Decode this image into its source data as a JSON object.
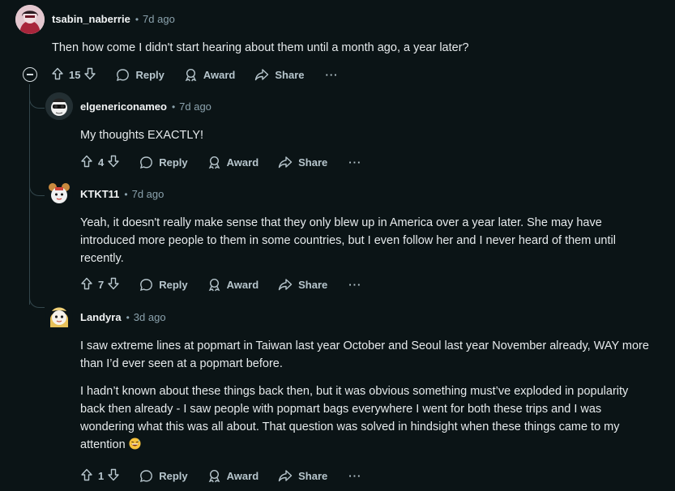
{
  "comments": [
    {
      "username": "tsabin_naberrie",
      "time": "7d ago",
      "body": [
        "Then how come I didn't start hearing about them until a month ago, a year later?"
      ],
      "votes": "15"
    },
    {
      "username": "elgenericonameo",
      "time": "7d ago",
      "body": [
        "My thoughts EXACTLY!"
      ],
      "votes": "4"
    },
    {
      "username": "KTKT11",
      "time": "7d ago",
      "body": [
        "Yeah, it doesn't really make sense that they only blew up in America over a year later. She may have introduced more people to them in some countries, but I even follow her and I never heard of them until recently."
      ],
      "votes": "7"
    },
    {
      "username": "Landyra",
      "time": "3d ago",
      "body": [
        "I saw extreme lines at popmart in Taiwan last year October and Seoul last year November already, WAY more than I’d ever seen at a popmart before.",
        "I hadn’t known about these things back then, but it was obvious something must’ve exploded in popularity back then already - I saw people with popmart bags everywhere I went for both these trips and I was wondering what this was all about. That question was solved in hindsight when these things came to my attention"
      ],
      "votes": "1"
    }
  ],
  "actions": {
    "reply": "Reply",
    "award": "Award",
    "share": "Share",
    "more": "···"
  },
  "colors": {
    "background": "#0b1416",
    "text": "#f2f4f5",
    "meta": "#8ba2ad",
    "thread_line": "#33464c"
  },
  "icons": [
    "upvote-icon",
    "downvote-icon",
    "reply-icon",
    "award-icon",
    "share-icon",
    "more-icon",
    "collapse-icon",
    "grinning-sweat-emoji"
  ]
}
